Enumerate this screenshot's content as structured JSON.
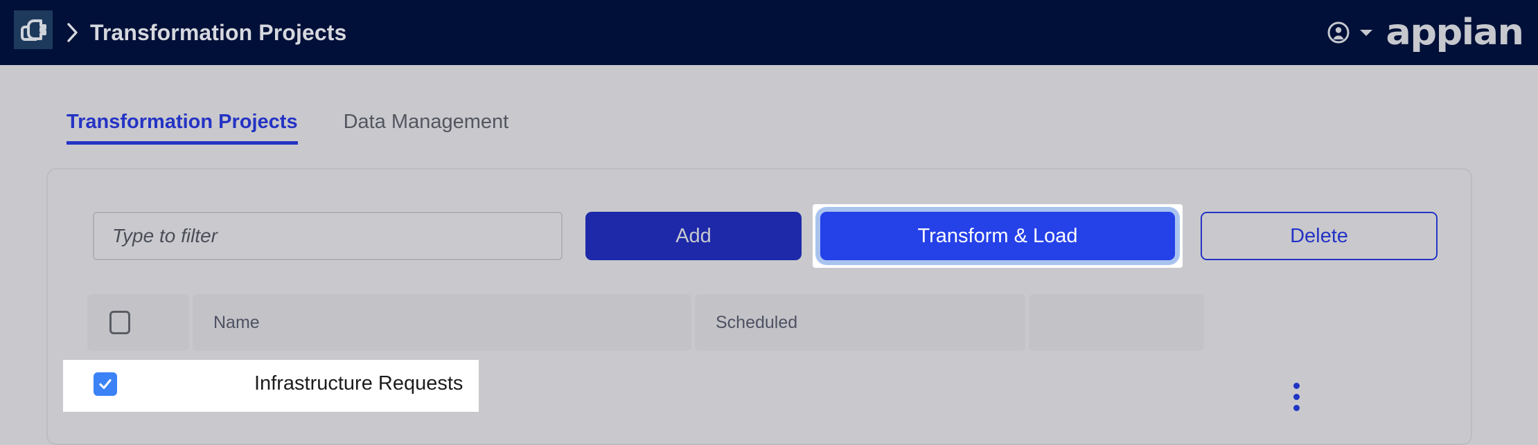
{
  "header": {
    "app_icon": "plug-connector-icon",
    "breadcrumb_chevron": "chevron-right-icon",
    "title": "Transformation Projects",
    "user_icon": "user-account-icon",
    "user_caret": "chevron-down-icon",
    "logo": "appian",
    "background_color": "#001038",
    "icon_tile_color": "#1d3a5c"
  },
  "tabs": [
    {
      "label": "Transformation Projects",
      "active": true
    },
    {
      "label": "Data Management",
      "active": false
    }
  ],
  "toolbar": {
    "filter": {
      "placeholder": "Type to filter",
      "value": ""
    },
    "add_label": "Add",
    "transform_label": "Transform & Load",
    "delete_label": "Delete",
    "focused_button": "Transform & Load",
    "primary_color": "#2541e8",
    "add_color": "#1d29a8",
    "outline_color": "#2433c4",
    "focus_ring_color": "#a9c3ef"
  },
  "table": {
    "columns": [
      {
        "key": "select",
        "label": ""
      },
      {
        "key": "name",
        "label": "Name"
      },
      {
        "key": "scheduled",
        "label": "Scheduled"
      },
      {
        "key": "actions",
        "label": ""
      }
    ],
    "select_all_checked": false,
    "rows": [
      {
        "selected": true,
        "name": "Infrastructure Requests",
        "scheduled": "",
        "actions_icon": "kebab-menu-icon"
      }
    ],
    "checkbox_checked_color": "#3b82f6",
    "header_bg": "#c3c3c7"
  },
  "page": {
    "background_color": "#c9c9cd",
    "card_border_color": "#bcbcc2"
  }
}
